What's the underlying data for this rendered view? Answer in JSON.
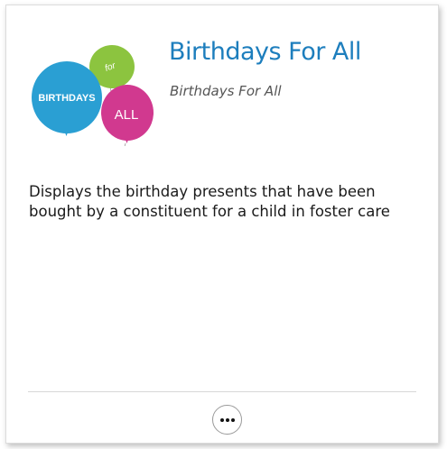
{
  "card": {
    "title": "Birthdays For All",
    "subtitle": "Birthdays For All",
    "description": "Displays the birthday presents that have been bought by a constituent for a child in foster care",
    "more_button": {
      "icon": "ellipsis-icon"
    }
  },
  "logo": {
    "balloon_big_text": "BIRTHDAYS",
    "balloon_small_text": "for",
    "balloon_pink_text": "ALL",
    "colors": {
      "blue": "#2a9fd3",
      "green": "#8cc43f",
      "pink": "#d1398f"
    }
  },
  "colors": {
    "title": "#1d7ebd"
  }
}
